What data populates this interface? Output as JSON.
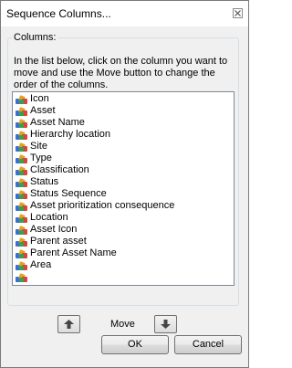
{
  "window": {
    "title": "Sequence Columns..."
  },
  "columns_group": {
    "legend": "Columns:",
    "instructions": "In the list below, click on the column you want to move and use the Move button to change the order of the columns."
  },
  "columns_list": {
    "items": [
      {
        "label": "Icon"
      },
      {
        "label": "Asset"
      },
      {
        "label": "Asset Name"
      },
      {
        "label": "Hierarchy location"
      },
      {
        "label": "Site"
      },
      {
        "label": "Type"
      },
      {
        "label": "Classification"
      },
      {
        "label": "Status"
      },
      {
        "label": "Status Sequence"
      },
      {
        "label": "Asset prioritization consequence"
      },
      {
        "label": "Location"
      },
      {
        "label": "Asset Icon"
      },
      {
        "label": "Parent asset"
      },
      {
        "label": "Parent Asset Name"
      },
      {
        "label": "Area"
      },
      {
        "label": ""
      }
    ],
    "item_icon": "colored-columns-icon"
  },
  "move": {
    "label": "Move",
    "up_icon": "arrow-up-icon",
    "down_icon": "arrow-down-icon"
  },
  "buttons": {
    "ok": "OK",
    "cancel": "Cancel"
  }
}
